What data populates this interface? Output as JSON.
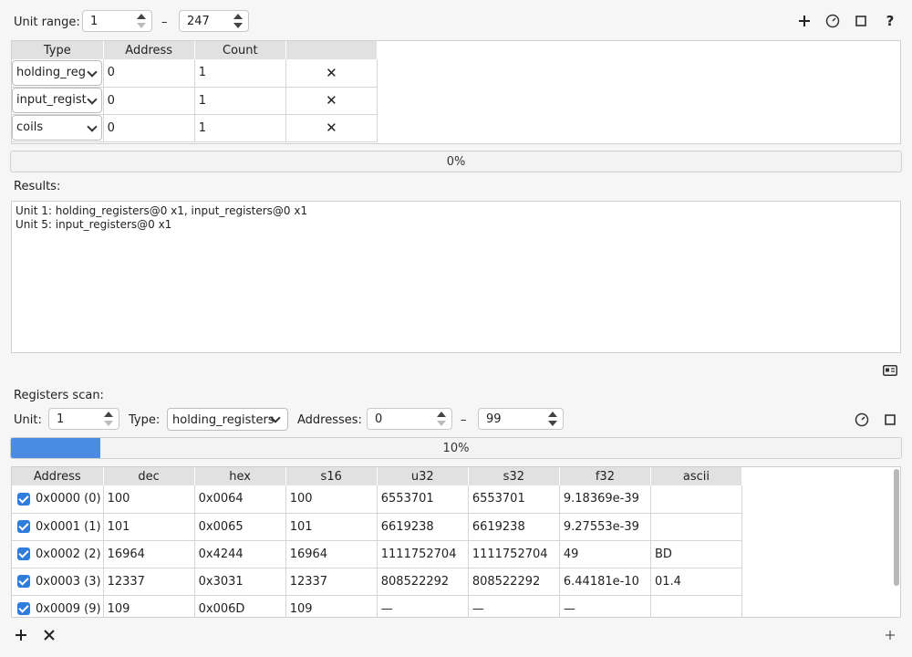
{
  "unit_range": {
    "label": "Unit range:",
    "from": "1",
    "to": "247",
    "dash": "–"
  },
  "toolbar_icons": [
    "add-icon",
    "scan-icon",
    "stop-icon",
    "help-icon"
  ],
  "range_table": {
    "headers": [
      "Type",
      "Address",
      "Count",
      ""
    ],
    "rows": [
      {
        "type": "holding_reg",
        "address": "0",
        "count": "1",
        "remove": "✕"
      },
      {
        "type": "input_regist",
        "address": "0",
        "count": "1",
        "remove": "✕"
      },
      {
        "type": "coils",
        "address": "0",
        "count": "1",
        "remove": "✕"
      }
    ]
  },
  "progress_top": {
    "percent": 0,
    "label": "0%"
  },
  "results": {
    "label": "Results:",
    "lines": [
      "Unit 1: holding_registers@0 x1, input_registers@0 x1",
      "Unit 5: input_registers@0 x1"
    ]
  },
  "registers_scan": {
    "label": "Registers scan:",
    "unit_label": "Unit:",
    "unit_value": "1",
    "type_label": "Type:",
    "type_value": "holding_registers",
    "addresses_label": "Addresses:",
    "addr_from": "0",
    "addr_to": "99",
    "dash": "–"
  },
  "progress_bottom": {
    "percent": 10,
    "label": "10%"
  },
  "reg_table": {
    "headers": [
      "Address",
      "dec",
      "hex",
      "s16",
      "u32",
      "s32",
      "f32",
      "ascii"
    ],
    "rows": [
      {
        "address": "0x0000 (0)",
        "dec": "100",
        "hex": "0x0064",
        "s16": "100",
        "u32": "6553701",
        "s32": "6553701",
        "f32": "9.18369e-39",
        "ascii": ""
      },
      {
        "address": "0x0001 (1)",
        "dec": "101",
        "hex": "0x0065",
        "s16": "101",
        "u32": "6619238",
        "s32": "6619238",
        "f32": "9.27553e-39",
        "ascii": ""
      },
      {
        "address": "0x0002 (2)",
        "dec": "16964",
        "hex": "0x4244",
        "s16": "16964",
        "u32": "1111752704",
        "s32": "1111752704",
        "f32": "49",
        "ascii": "BD"
      },
      {
        "address": "0x0003 (3)",
        "dec": "12337",
        "hex": "0x3031",
        "s16": "12337",
        "u32": "808522292",
        "s32": "808522292",
        "f32": "6.44181e-10",
        "ascii": "01.4"
      },
      {
        "address": "0x0009 (9)",
        "dec": "109",
        "hex": "0x006D",
        "s16": "109",
        "u32": "—",
        "s32": "—",
        "f32": "—",
        "ascii": ""
      }
    ]
  },
  "colors": {
    "accent": "#4a8ce4",
    "checkbox": "#2e7cdc",
    "header_bg": "#e1e1e1"
  }
}
